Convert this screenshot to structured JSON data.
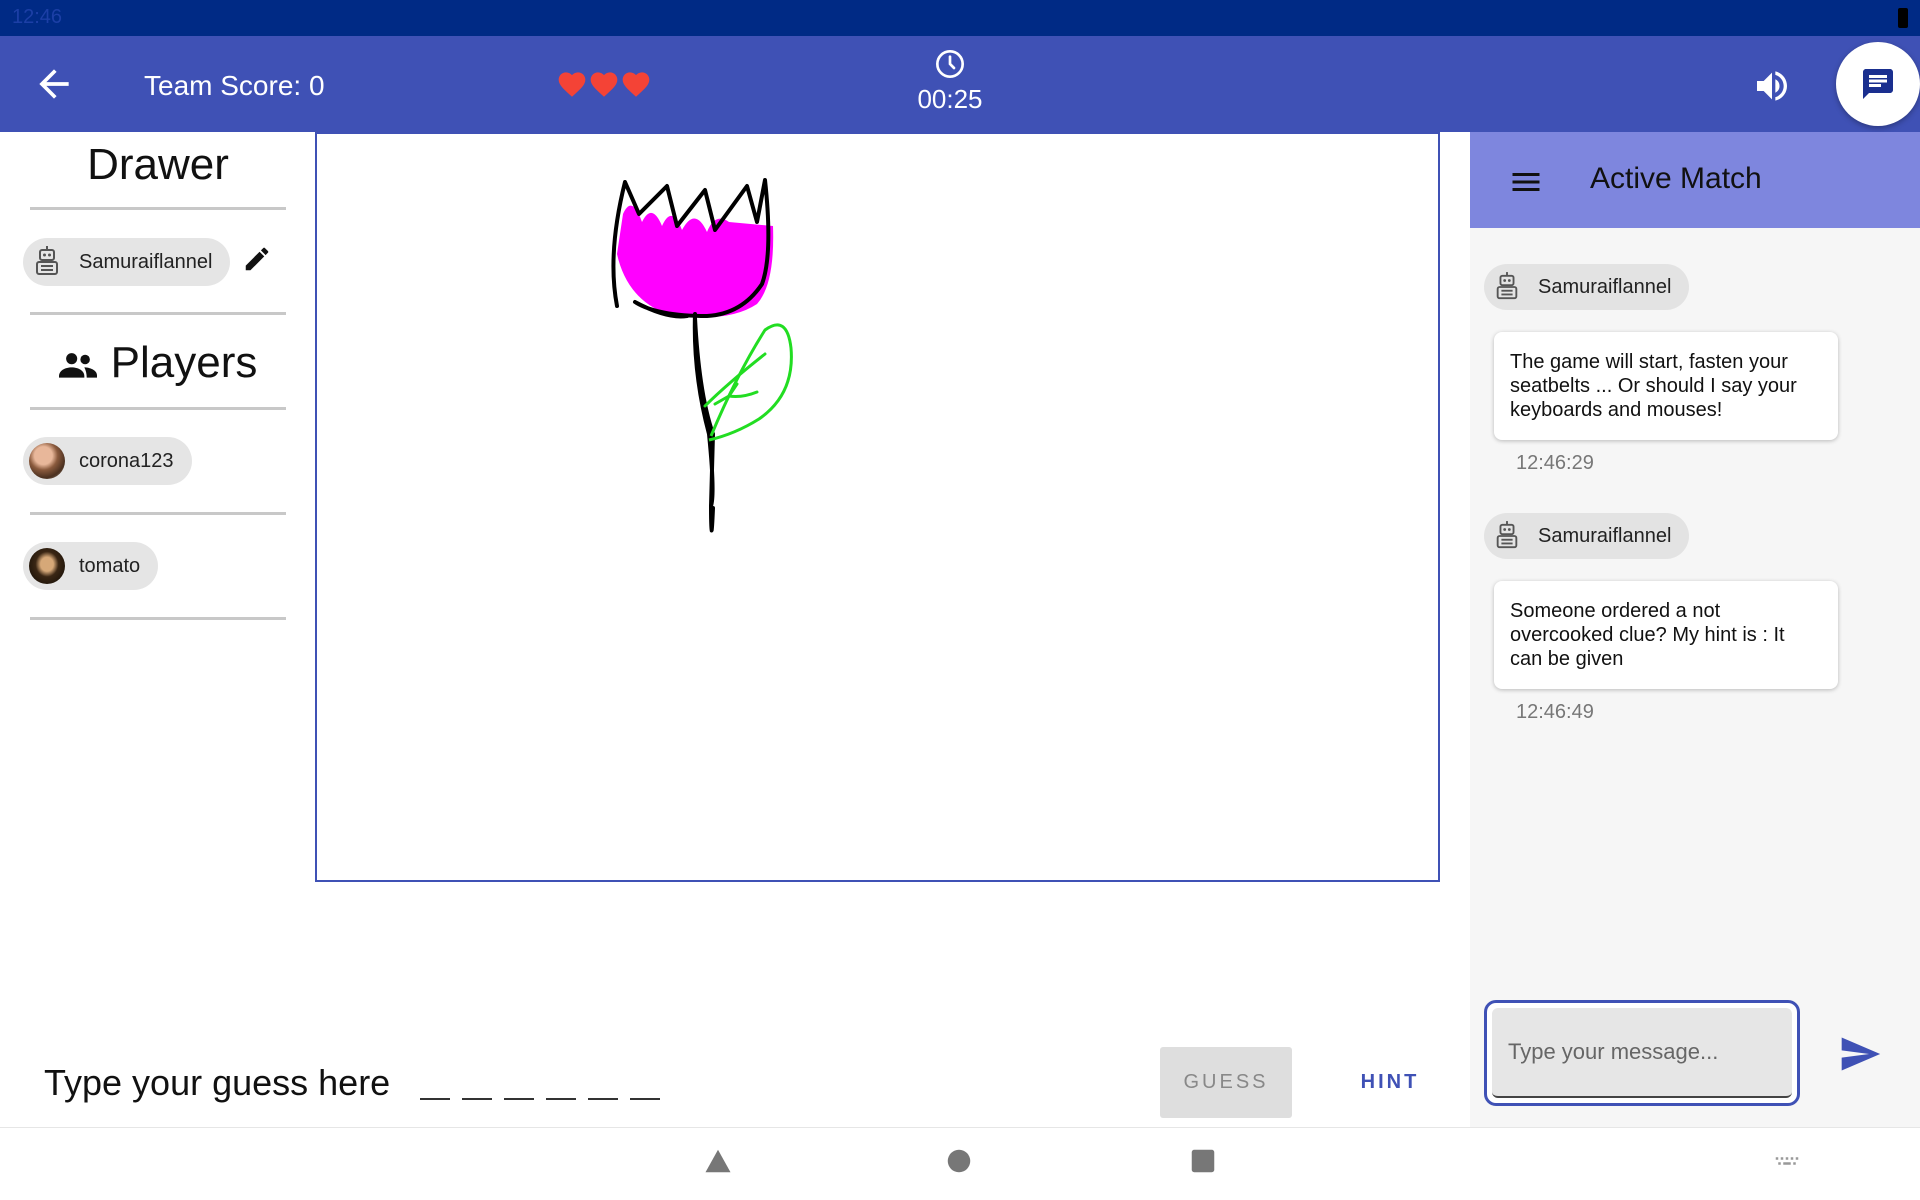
{
  "status_bar": {
    "time": "12:46"
  },
  "app_bar": {
    "team_score": "Team Score: 0",
    "lives": 3,
    "timer": "00:25",
    "colors": {
      "primary": "#3f51b5",
      "status": "#002a85",
      "heart": "#f44336"
    }
  },
  "left": {
    "drawer_title": "Drawer",
    "drawer": {
      "name": "Samuraiflannel",
      "avatar": "robot-icon"
    },
    "players_title": "Players",
    "players": [
      {
        "name": "corona123",
        "avatar": "photo-avatar"
      },
      {
        "name": "tomato",
        "avatar": "photo-avatar"
      }
    ]
  },
  "guess": {
    "label": "Type your guess here",
    "blank_count": 6,
    "guess_button": "GUESS",
    "hint_button": "HINT"
  },
  "chat": {
    "title": "Active Match",
    "messages": [
      {
        "author": "Samuraiflannel",
        "text": "The game will start, fasten your seatbelts ... Or should I say your keyboards and mouses!",
        "time": "12:46:29"
      },
      {
        "author": "Samuraiflannel",
        "text": "Someone ordered a not overcooked clue? My hint is : It can be given",
        "time": "12:46:49"
      }
    ],
    "input_placeholder": "Type your message...",
    "accent": "#7e86de"
  }
}
